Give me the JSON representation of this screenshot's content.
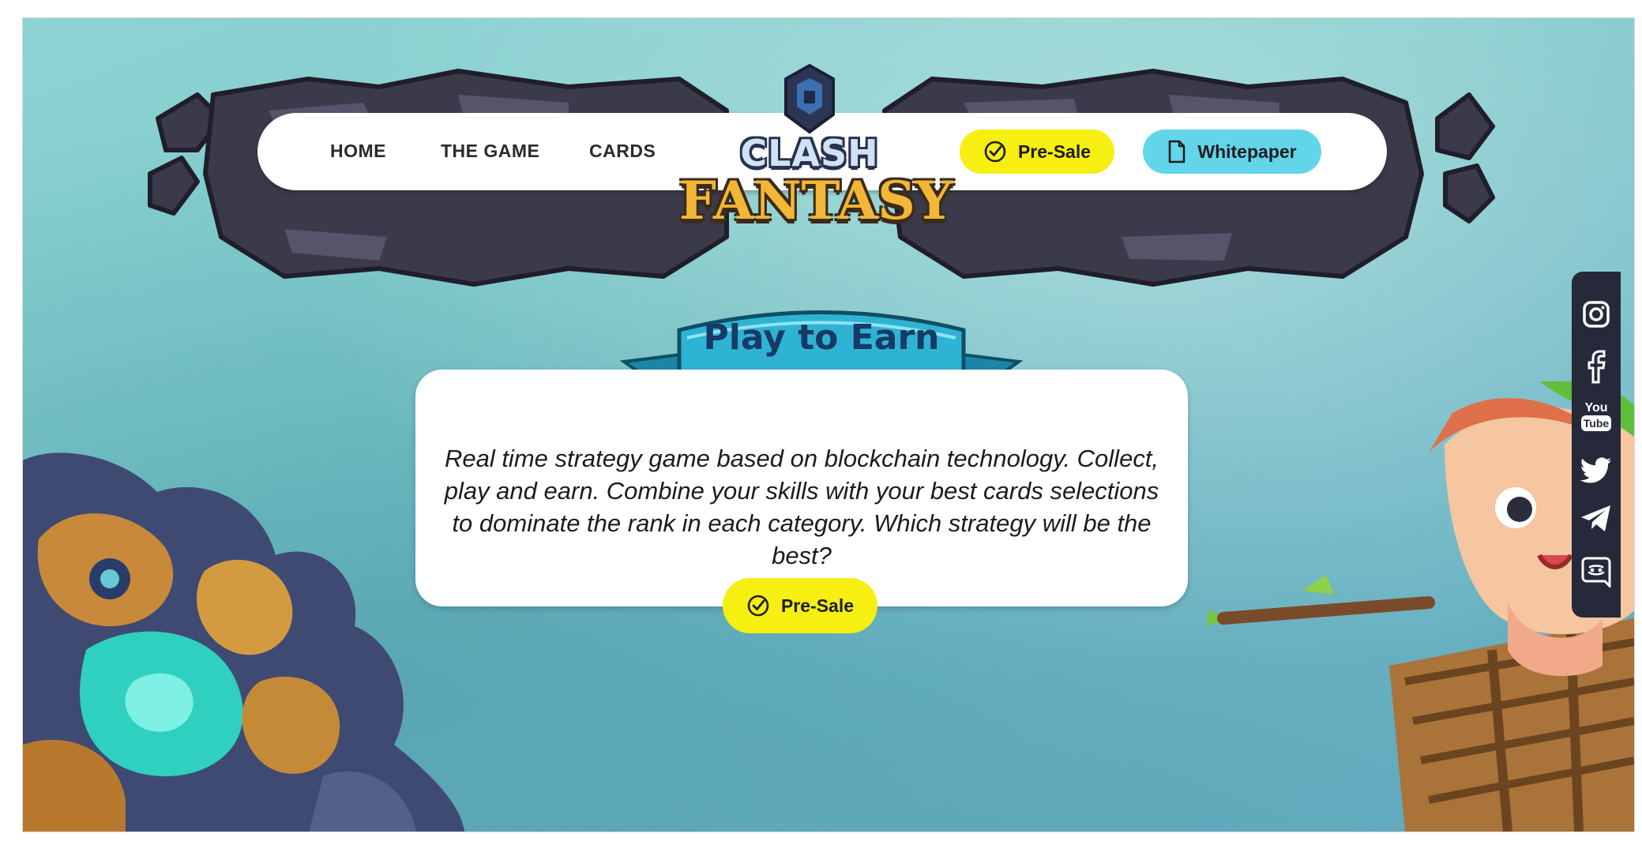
{
  "brand": {
    "logo_line1": "CLASH",
    "logo_line2": "FANTASY"
  },
  "nav": {
    "links": [
      {
        "label": "HOME"
      },
      {
        "label": "THE GAME"
      },
      {
        "label": "CARDS"
      }
    ],
    "presale_label": "Pre-Sale",
    "whitepaper_label": "Whitepaper"
  },
  "hero": {
    "banner_title": "Play to Earn",
    "description": "Real time strategy game based on blockchain technology. Collect, play and earn. Combine your skills with your best cards selections to dominate the rank in each category. Which strategy will be the best?",
    "cta_label": "Pre-Sale"
  },
  "social": {
    "icons": [
      "instagram-icon",
      "facebook-icon",
      "youtube-icon",
      "twitter-icon",
      "telegram-icon",
      "discord-icon"
    ],
    "youtube_top": "You",
    "youtube_bottom": "Tube"
  },
  "colors": {
    "presale_yellow": "#f7ee12",
    "whitepaper_cyan": "#63d5ea",
    "sidebar_dark": "#26293a",
    "banner_text": "#173a66"
  }
}
